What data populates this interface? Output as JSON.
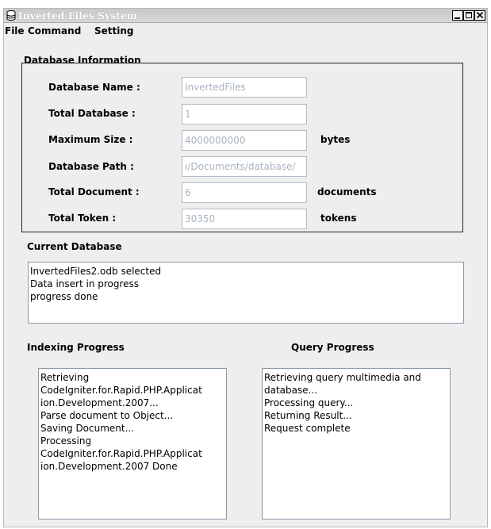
{
  "window": {
    "title": "Inverted Files System"
  },
  "menu": [
    "File",
    "Command",
    "Setting"
  ],
  "db_info": {
    "section_title": "Database Information",
    "fields": [
      {
        "label": "Database Name :",
        "value": "InvertedFiles",
        "unit": ""
      },
      {
        "label": "Total Database :",
        "value": "1",
        "unit": ""
      },
      {
        "label": "Maximum Size :",
        "value": "4000000000",
        "unit": "bytes"
      },
      {
        "label": "Database Path :",
        "value": "ı/Documents/database/",
        "unit": ""
      },
      {
        "label": "Total Document :",
        "value": "6",
        "unit": "documents"
      },
      {
        "label": "Total Token :",
        "value": "30350",
        "unit": "tokens"
      }
    ]
  },
  "current_db": {
    "title": "Current Database",
    "lines": [
      "InvertedFiles2.odb selected",
      "Data insert in progress",
      "progress done"
    ]
  },
  "indexing": {
    "title": "Indexing Progress",
    "lines": [
      "Retrieving",
      "CodeIgniter.for.Rapid.PHP.Applicat",
      "ion.Development.2007...",
      "Parse document to Object...",
      "Saving Document...",
      "Processing",
      "CodeIgniter.for.Rapid.PHP.Applicat",
      "ion.Development.2007 Done"
    ]
  },
  "query": {
    "title": "Query Progress",
    "lines": [
      "Retrieving query multimedia and",
      "database...",
      "Processing query...",
      "Returning Result...",
      "Request complete"
    ]
  }
}
